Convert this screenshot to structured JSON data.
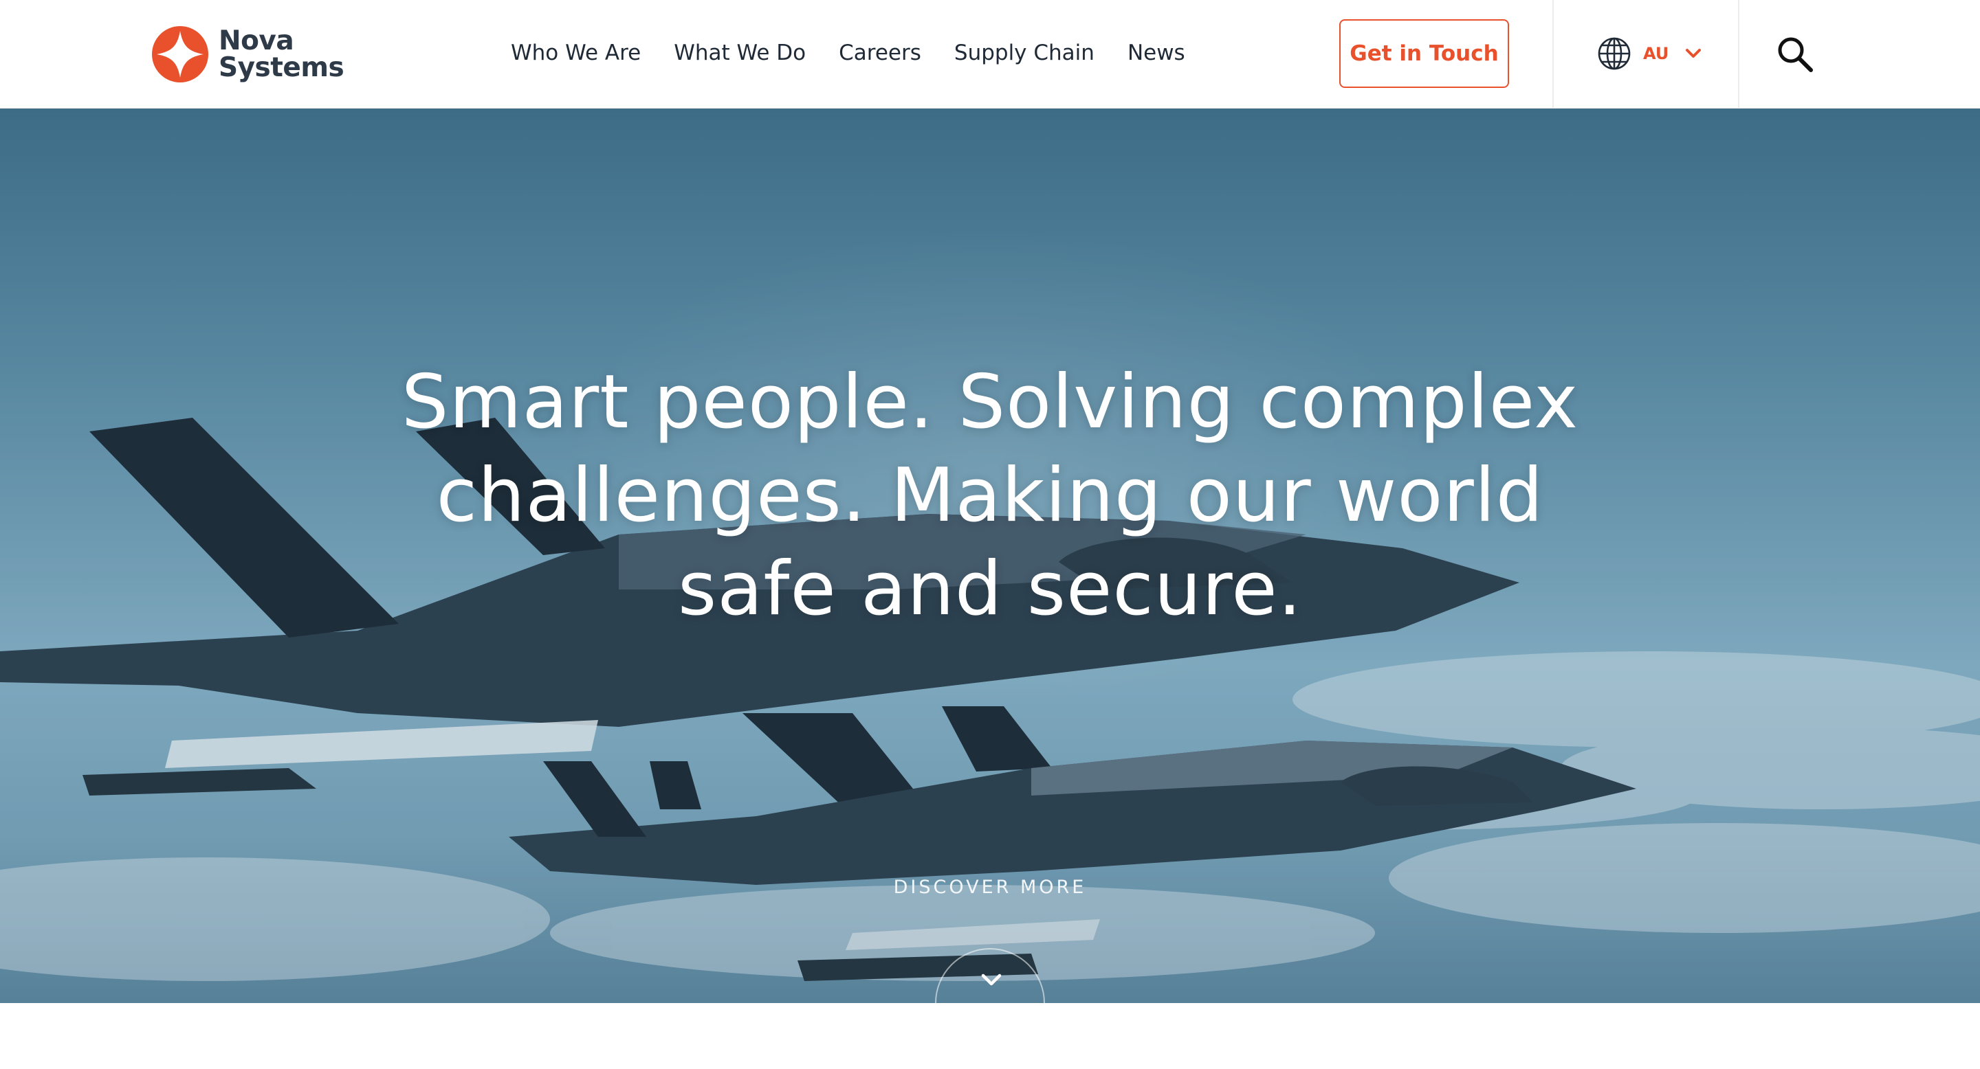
{
  "brand": {
    "line1": "Nova",
    "line2": "Systems",
    "accent_color": "#e8512b",
    "text_color": "#2e3a47"
  },
  "nav": {
    "items": [
      {
        "label": "Who We Are"
      },
      {
        "label": "What We Do"
      },
      {
        "label": "Careers"
      },
      {
        "label": "Supply Chain"
      },
      {
        "label": "News"
      }
    ]
  },
  "header": {
    "cta_label": "Get in Touch",
    "region_code": "AU",
    "region_icon": "globe-icon",
    "search_icon": "search-icon"
  },
  "hero": {
    "title": "Smart people. Solving complex challenges. Making our world safe and secure.",
    "discover_label": "DISCOVER MORE",
    "scroll_icon": "chevron-down-icon",
    "image": "two fighter jets in flight over clouds"
  }
}
